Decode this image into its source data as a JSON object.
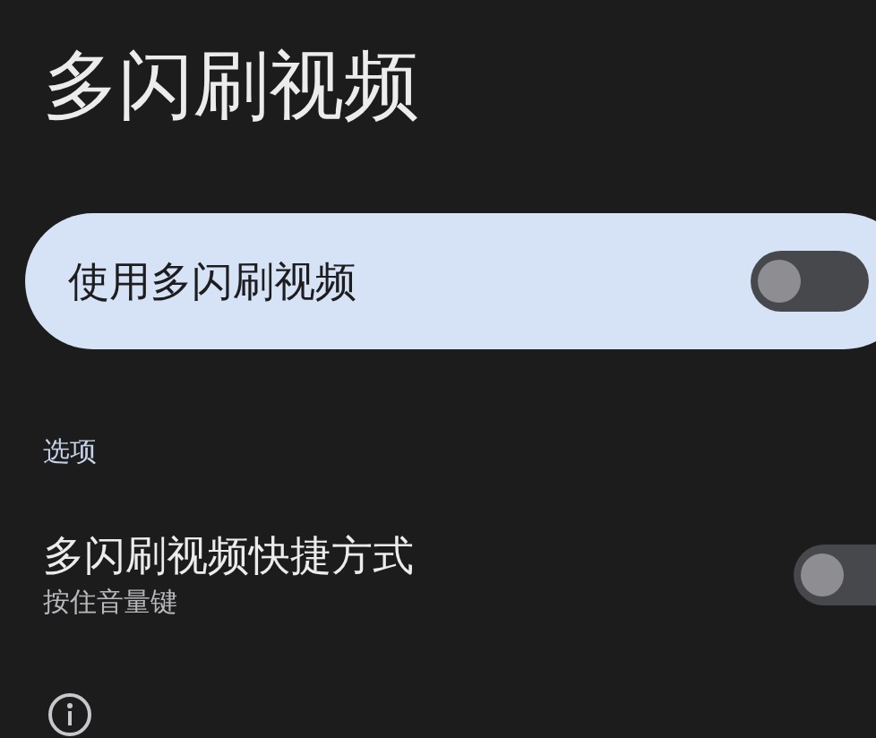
{
  "title": "多闪刷视频",
  "main_switch": {
    "label": "使用多闪刷视频",
    "on": false
  },
  "section": {
    "title": "选项"
  },
  "options": [
    {
      "title": "多闪刷视频快捷方式",
      "subtitle": "按住音量键",
      "on": false
    }
  ]
}
